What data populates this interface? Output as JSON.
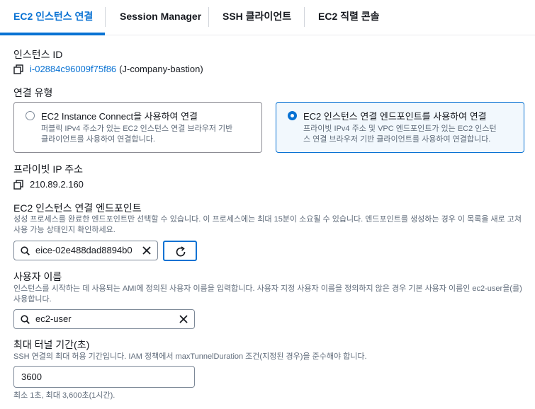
{
  "tabs": [
    {
      "label": "EC2 인스턴스 연결",
      "active": true
    },
    {
      "label": "Session Manager",
      "active": false
    },
    {
      "label": "SSH 클라이언트",
      "active": false
    },
    {
      "label": "EC2 직렬 콘솔",
      "active": false
    }
  ],
  "instance": {
    "label": "인스턴스 ID",
    "id": "i-02884c96009f75f86",
    "name": "(J-company-bastion)"
  },
  "connection_type": {
    "label": "연결 유형",
    "options": [
      {
        "title": "EC2 Instance Connect을 사용하여 연결",
        "desc_line1": "퍼블릭 IPv4 주소가 있는 EC2 인스턴스 연결 브라우저 기반",
        "desc_line2": "클라이언트를 사용하여 연결합니다.",
        "selected": false
      },
      {
        "title": "EC2 인스턴스 연결 엔드포인트를 사용하여 연결",
        "desc_line1": "프라이빗 IPv4 주소 및 VPC 엔드포인트가 있는 EC2 인스턴",
        "desc_line2": "스 연결 브라우저 기반 클라이언트를 사용하여 연결합니다.",
        "selected": true
      }
    ]
  },
  "private_ip": {
    "label": "프라이빗 IP 주소",
    "value": "210.89.2.160"
  },
  "endpoint": {
    "label": "EC2 인스턴스 연결 엔드포인트",
    "desc": "성성 프로세스를 완료한 엔드포인트만 선택할 수 있습니다. 이 프로세스에는 최대 15분이 소요될 수 있습니다. 엔드포인트를 생성하는 경우 이 목록을 새로 고쳐 사용 가능 상태인지 확인하세요.",
    "value": "eice-02e488dad8894b0"
  },
  "username": {
    "label": "사용자 이름",
    "desc": "인스턴스를 시작하는 데 사용되는 AMI에 정의된 사용자 이름을 입력합니다. 사용자 지정 사용자 이름을 정의하지 않은 경우 기본 사용자 이름인 ec2-user을(를) 사용합니다.",
    "value": "ec2-user"
  },
  "tunnel": {
    "label": "최대 터널 기간(초)",
    "desc": "SSH 연결의 최대 허용 기간입니다. IAM 정책에서 maxTunnelDuration 조건(지정된 경우)을 준수해야 합니다.",
    "value": "3600",
    "hint": "최소 1초, 최대 3,600초(1시간)."
  },
  "colors": {
    "accent": "#0972d3",
    "muted": "#5f6b7a",
    "text": "#16191f"
  }
}
